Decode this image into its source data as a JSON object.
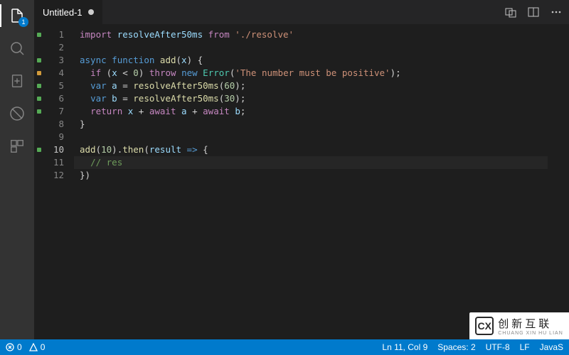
{
  "activity": {
    "explorer_badge": "1"
  },
  "tab": {
    "title": "Untitled-1"
  },
  "code": {
    "lines": [
      "1",
      "2",
      "3",
      "4",
      "5",
      "6",
      "7",
      "8",
      "9",
      "10",
      "11",
      "12"
    ],
    "marks": [
      "green",
      "",
      "green",
      "orange",
      "green",
      "green",
      "green",
      "",
      "",
      "green",
      "",
      ""
    ],
    "l1": {
      "import": "import",
      "name": "resolveAfter50ms",
      "from": "from",
      "path": "'./resolve'"
    },
    "l3": {
      "async": "async",
      "function": "function",
      "name": "add",
      "p": "(",
      "arg": "x",
      "cp": ") {"
    },
    "l4": {
      "if": "if",
      "p": " (",
      "x": "x",
      "op": " < ",
      "zero": "0",
      "cp": ") ",
      "throw": "throw",
      "new": "new",
      "err": "Error",
      "op2": "(",
      "msg": "'The number must be positive'",
      "cp2": ");"
    },
    "l5": {
      "var": "var",
      "a": "a",
      "eq": " = ",
      "fn": "resolveAfter50ms",
      "p": "(",
      "n": "60",
      "cp": ");"
    },
    "l6": {
      "var": "var",
      "b": "b",
      "eq": " = ",
      "fn": "resolveAfter50ms",
      "p": "(",
      "n": "30",
      "cp": ");"
    },
    "l7": {
      "return": "return",
      "x": "x",
      "p1": " + ",
      "await1": "await",
      "a": "a",
      "p2": " + ",
      "await2": "await",
      "b": "b",
      "semi": ";"
    },
    "l8": {
      "brace": "}"
    },
    "l10": {
      "fn": "add",
      "p": "(",
      "n": "10",
      "cp": ").",
      "then": "then",
      "p2": "(",
      "res": "result",
      "arrow": " => ",
      "ob": "{"
    },
    "l11": {
      "cmt": "// res"
    },
    "l12": {
      "close": "})"
    }
  },
  "status": {
    "errors": "0",
    "warnings": "0",
    "position": "Ln 11, Col 9",
    "spaces": "Spaces: 2",
    "encoding": "UTF-8",
    "eol": "LF",
    "lang": "JavaS"
  },
  "watermark": {
    "brand": "创新互联",
    "py": "CHUANG XIN HU LIAN",
    "logo": "CX"
  }
}
